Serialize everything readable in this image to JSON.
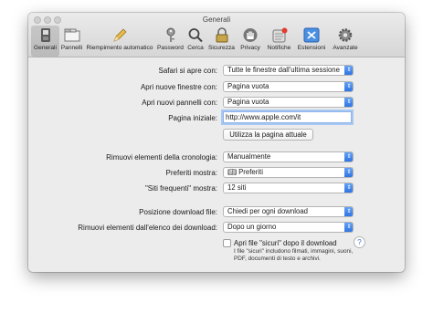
{
  "window": {
    "title": "Generali"
  },
  "toolbar": {
    "items": [
      {
        "label": "Generali",
        "icon": "general-switch-icon"
      },
      {
        "label": "Pannelli",
        "icon": "tabs-icon"
      },
      {
        "label": "Riempimento automatico",
        "icon": "autofill-pencil-icon"
      },
      {
        "label": "Password",
        "icon": "key-icon"
      },
      {
        "label": "Cerca",
        "icon": "magnifier-icon"
      },
      {
        "label": "Sicurezza",
        "icon": "padlock-icon"
      },
      {
        "label": "Privacy",
        "icon": "hand-icon"
      },
      {
        "label": "Notifiche",
        "icon": "notifications-icon"
      },
      {
        "label": "Estensioni",
        "icon": "puzzle-icon"
      },
      {
        "label": "Avanzate",
        "icon": "gear-icon"
      }
    ]
  },
  "form": {
    "open_with_label": "Safari si apre con:",
    "open_with_value": "Tutte le finestre dall'ultima sessione",
    "new_windows_label": "Apri nuove finestre con:",
    "new_windows_value": "Pagina vuota",
    "new_tabs_label": "Apri nuovi pannelli con:",
    "new_tabs_value": "Pagina vuota",
    "homepage_label": "Pagina iniziale:",
    "homepage_value": "http://www.apple.com/it",
    "use_current_button": "Utilizza la pagina attuale",
    "history_label": "Rimuovi elementi della cronologia:",
    "history_value": "Manualmente",
    "favorites_label": "Preferiti mostra:",
    "favorites_value": "Preferiti",
    "top_sites_label": "\"Siti frequenti\" mostra:",
    "top_sites_value": "12 siti",
    "download_location_label": "Posizione download file:",
    "download_location_value": "Chiedi per ogni download",
    "remove_downloads_label": "Rimuovi elementi dall'elenco dei download:",
    "remove_downloads_value": "Dopo un giorno",
    "open_safe_files_label": "Apri file \"sicuri\" dopo il download",
    "open_safe_files_checked": false,
    "open_safe_files_note": "I file \"sicuri\" includono filmati, immagini, suoni, PDF, documenti di testo e archivi."
  },
  "help": {
    "label": "?"
  },
  "colors": {
    "accent": "#2a6fe0",
    "window_bg": "#ececec"
  }
}
